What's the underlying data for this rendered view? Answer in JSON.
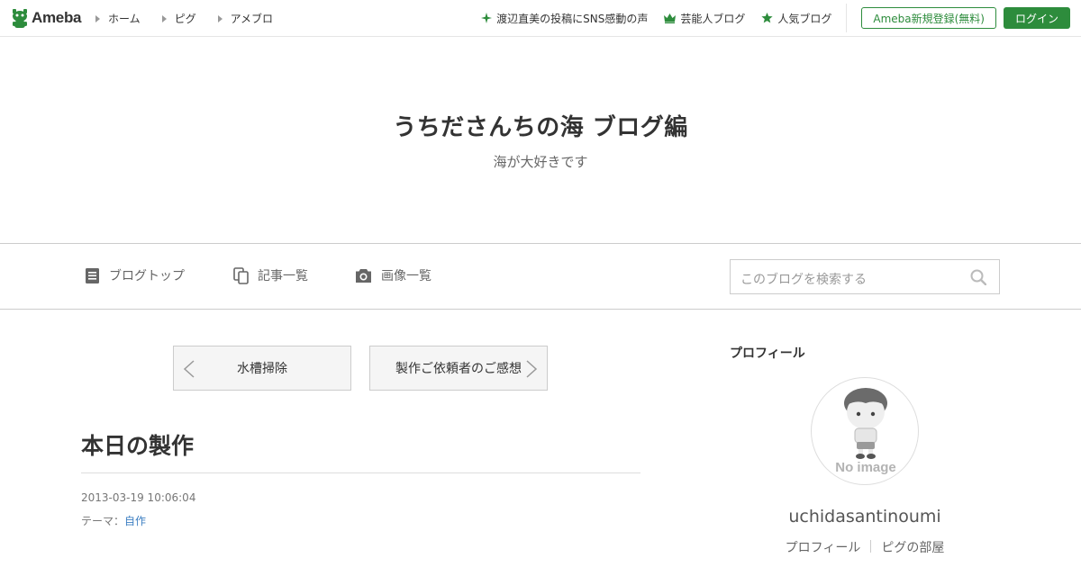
{
  "global_header": {
    "logo_text": "Ameba",
    "nav": [
      {
        "label": "ホーム"
      },
      {
        "label": "ピグ"
      },
      {
        "label": "アメブロ"
      }
    ],
    "links": [
      {
        "label": "渡辺直美の投稿にSNS感動の声",
        "icon": "sparkle-icon"
      },
      {
        "label": "芸能人ブログ",
        "icon": "crown-icon"
      },
      {
        "label": "人気ブログ",
        "icon": "star-icon"
      }
    ],
    "register_label": "Ameba新規登録(無料)",
    "login_label": "ログイン"
  },
  "blog": {
    "title": "うちださんちの海 ブログ編",
    "description": "海が大好きです"
  },
  "blog_nav": {
    "items": [
      {
        "label": "ブログトップ",
        "icon": "document-icon"
      },
      {
        "label": "記事一覧",
        "icon": "copy-icon"
      },
      {
        "label": "画像一覧",
        "icon": "camera-icon"
      }
    ],
    "search_placeholder": "このブログを検索する"
  },
  "pager": {
    "prev_label": "水槽掃除",
    "next_label": "製作ご依頼者のご感想"
  },
  "article": {
    "title": "本日の製作",
    "date": "2013-03-19 10:06:04",
    "theme_prefix": "テーマ：",
    "theme_label": "自作"
  },
  "profile": {
    "heading": "プロフィール",
    "avatar_caption": "No image",
    "username": "uchidasantinoumi",
    "links": [
      {
        "label": "プロフィール"
      },
      {
        "label": "ピグの部屋"
      }
    ]
  },
  "colors": {
    "ameba_green": "#2d8c3c",
    "link_blue": "#3d7fc2"
  }
}
